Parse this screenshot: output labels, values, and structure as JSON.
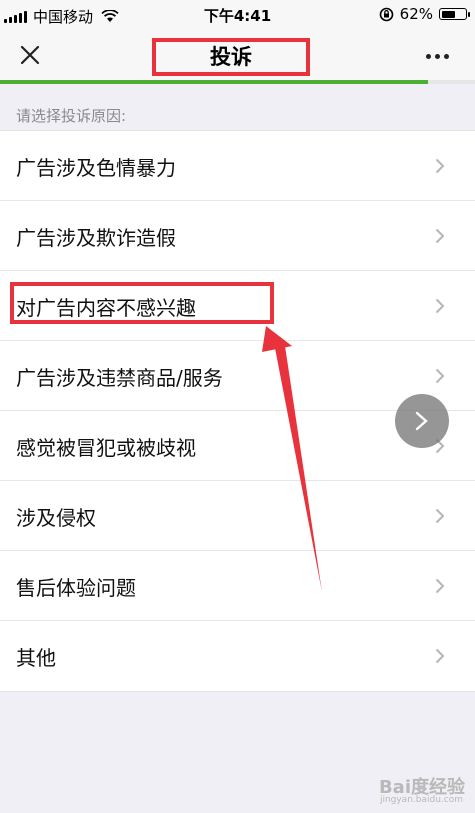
{
  "status_bar": {
    "carrier": "中国移动",
    "time": "下午4:41",
    "battery": "62%",
    "battery_level": 0.62
  },
  "nav": {
    "title": "投诉",
    "progress": 0.9
  },
  "section_label": "请选择投诉原因:",
  "reasons": [
    "广告涉及色情暴力",
    "广告涉及欺诈造假",
    "对广告内容不感兴趣",
    "广告涉及违禁商品/服务",
    "感觉被冒犯或被歧视",
    "涉及侵权",
    "售后体验问题",
    "其他"
  ],
  "watermark": {
    "text": "Bai度经验",
    "sub": "jingyan.baidu.com"
  },
  "colors": {
    "annotation": "#e8333d",
    "progress": "#4caf35",
    "background": "#f0eff5"
  }
}
